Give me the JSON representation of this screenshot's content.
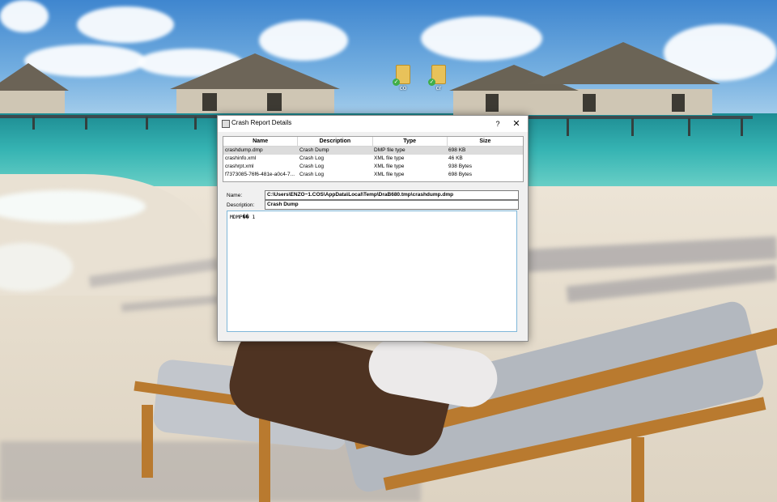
{
  "desktop": {
    "icons": [
      {
        "name": "document-icon",
        "label": "co"
      },
      {
        "name": "document-icon",
        "label": "cr"
      }
    ]
  },
  "dialog": {
    "title": "Crash Report Details",
    "help_glyph": "?",
    "close_glyph": "✕",
    "table": {
      "columns": [
        "Name",
        "Description",
        "Type",
        "Size"
      ],
      "rows": [
        {
          "name": "crashdump.dmp",
          "description": "Crash Dump",
          "type": "DMP file type",
          "size": "698 KB"
        },
        {
          "name": "crashinfo.xml",
          "description": "Crash Log",
          "type": "XML file type",
          "size": "46 KB"
        },
        {
          "name": "crashrpt.xml",
          "description": "Crash Log",
          "type": "XML file type",
          "size": "938 Bytes"
        },
        {
          "name": "f7373085-76f6-481e-a0c4-7...",
          "description": "Crash Log",
          "type": "XML file type",
          "size": "698 Bytes"
        }
      ]
    },
    "name_label": "Name:",
    "name_value": "C:\\Users\\ENZO~1.COS\\AppData\\Local\\Temp\\DraB680.tmp\\crashdump.dmp",
    "description_label": "Description:",
    "description_value": "Crash Dump",
    "content_preview": "MDMP��  1"
  },
  "colors": {
    "selection": "#dcdcdc",
    "content_border": "#7fb7d9",
    "dialog_bg": "#f0f0f0"
  }
}
